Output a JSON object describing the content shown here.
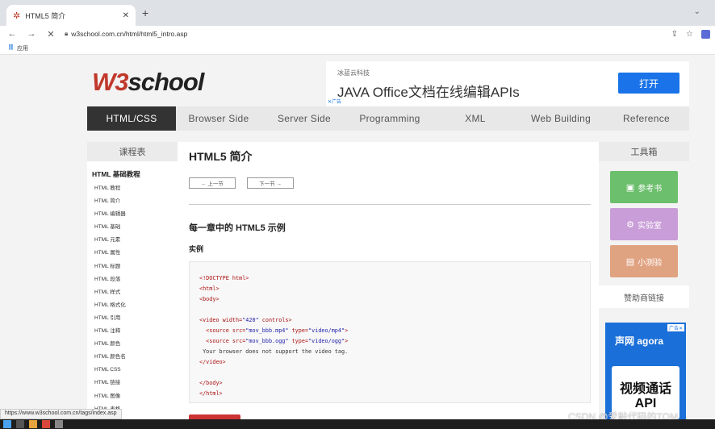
{
  "browser": {
    "tab_title": "HTML5 简介",
    "url": "w3school.com.cn/html/html5_intro.asp",
    "bookmark_label": "应用"
  },
  "site": {
    "logo_w3": "W3",
    "logo_school": "school",
    "ad": {
      "subtitle": "冰蓝云科技",
      "title": "JAVA Office文档在线编辑APIs",
      "button": "打开",
      "mark": "✕广告"
    },
    "nav": [
      "HTML/CSS",
      "Browser Side",
      "Server Side",
      "Programming",
      "XML",
      "Web Building",
      "Reference"
    ]
  },
  "sidebar": {
    "header": "课程表",
    "section": "HTML 基础教程",
    "links": [
      "HTML 教程",
      "HTML 简介",
      "HTML 编辑器",
      "HTML 基础",
      "HTML 元素",
      "HTML 属性",
      "HTML 标题",
      "HTML 段落",
      "HTML 样式",
      "HTML 格式化",
      "HTML 引用",
      "HTML 注释",
      "HTML 颜色",
      "HTML 颜色名",
      "HTML CSS",
      "HTML 链接",
      "HTML 图像",
      "HTML 表格"
    ]
  },
  "content": {
    "title": "HTML5 简介",
    "prev": "← 上一节",
    "next": "下一节 →",
    "section_title": "每一章中的 HTML5 示例",
    "example_label": "实例"
  },
  "code": {
    "l1": "<!DOCTYPE html>",
    "l2": "<html>",
    "l3": "<body>",
    "l4a": "<video ",
    "l4b": "width=",
    "l4c": "\"420\"",
    "l4d": " controls>",
    "l5a": "  <source ",
    "l5b": "src=",
    "l5c": "\"mov_bbb.mp4\"",
    "l5d": " type=",
    "l5e": "\"video/mp4\"",
    "l5f": ">",
    "l6a": "  <source ",
    "l6b": "src=",
    "l6c": "\"mov_bbb.ogg\"",
    "l6d": " type=",
    "l6e": "\"video/ogg\"",
    "l6f": ">",
    "l7": " Your browser does not support the video tag.",
    "l8": "</video>",
    "l9": "</body>",
    "l10": "</html>"
  },
  "toolbox": {
    "header": "工具箱",
    "reference": "参考书",
    "lab": "实验室",
    "quiz": "小测验",
    "sponsor_header": "赞助商链接",
    "sponsor_brand": "声网 agora",
    "sponsor_line1": "视频通话",
    "sponsor_line2": "API",
    "sponsor_mark": "广告✕"
  },
  "status_url": "https://www.w3school.com.cn/tags/index.asp",
  "watermark": "CSDN @爱敲代码的TOM",
  "colors": {
    "brand_red": "#c0392b",
    "nav_active": "#333333",
    "reference_green": "#6cbf6c",
    "lab_purple": "#c99ed8",
    "quiz_orange": "#e0a382",
    "ad_blue": "#1a73e8"
  },
  "icons": {
    "tab_favicon": "w3school-favicon",
    "reference": "book-icon",
    "lab": "gear-icon",
    "quiz": "clipboard-icon"
  }
}
